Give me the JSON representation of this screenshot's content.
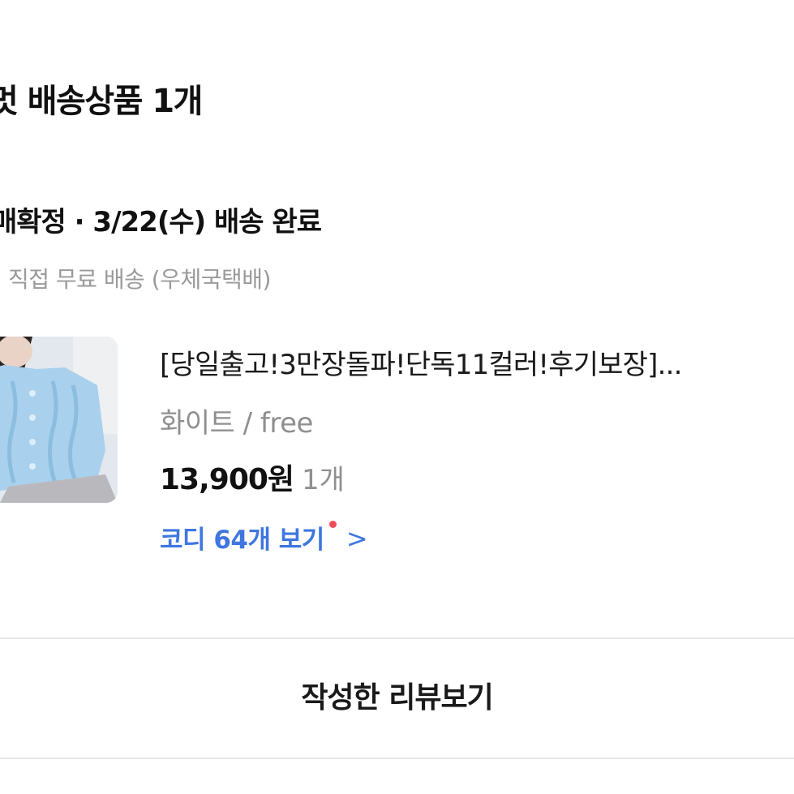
{
  "section": {
    "title": "멋 배송상품 1개"
  },
  "delivery": {
    "status": "매확정 · 3/22(수) 배송 완료",
    "shipping_info": "직접 무료 배송 (우체국택배)"
  },
  "product": {
    "name": "[당일출고!3만장돌파!단독11컬러!후기보장]...",
    "option": "화이트 / free",
    "price": "13,900원",
    "quantity": "1개",
    "coordi_link": "코디 64개 보기",
    "chevron": ">",
    "image_colors": {
      "sweater": "#a9d0ec",
      "background": "#dfe6ee",
      "skirt": "#b9b9bd"
    }
  },
  "actions": {
    "review_button": "작성한 리뷰보기"
  },
  "colors": {
    "link": "#3f76e0",
    "notification_dot": "#f24b5c",
    "muted_text": "#8f8f8f"
  }
}
